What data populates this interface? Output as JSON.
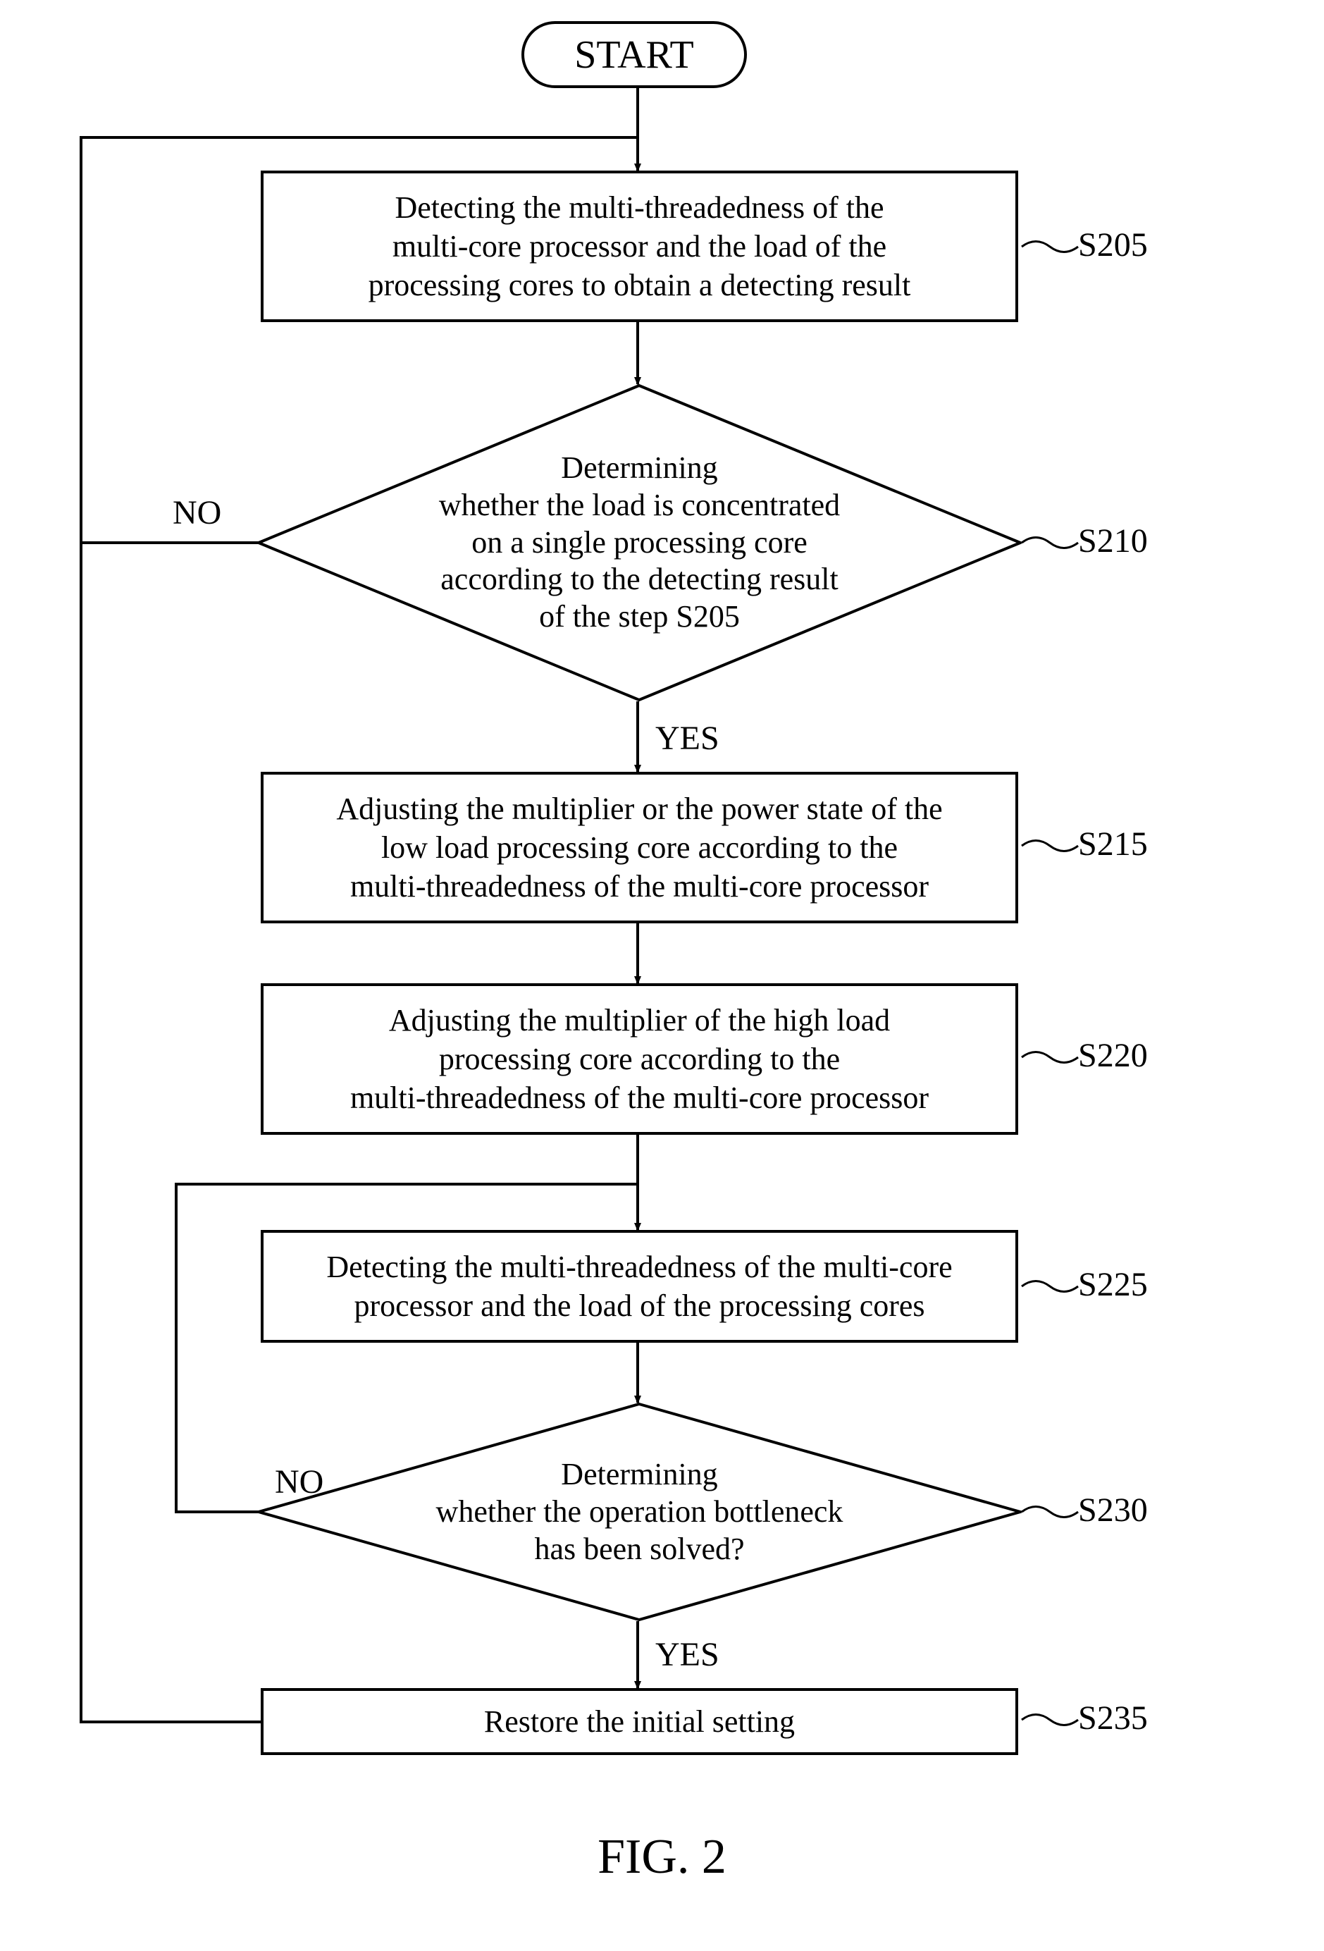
{
  "start": "START",
  "s205": {
    "text": "Detecting the multi-threadedness of the\nmulti-core processor and the load of the\nprocessing cores to obtain a detecting result",
    "id": "S205"
  },
  "s210": {
    "text": "Determining\nwhether the load is concentrated\non a single processing core\naccording to the detecting result\nof the step S205",
    "id": "S210"
  },
  "s215": {
    "text": "Adjusting the multiplier or the power state of the\nlow load processing core according to the\nmulti-threadedness of the multi-core processor",
    "id": "S215"
  },
  "s220": {
    "text": "Adjusting the multiplier of the high load\nprocessing core according to the\nmulti-threadedness of the multi-core processor",
    "id": "S220"
  },
  "s225": {
    "text": "Detecting the multi-threadedness of the multi-core\nprocessor and the load of the processing cores",
    "id": "S225"
  },
  "s230": {
    "text": "Determining\nwhether the operation bottleneck\nhas been solved?",
    "id": "S230"
  },
  "s235": {
    "text": "Restore the initial setting",
    "id": "S235"
  },
  "no": "NO",
  "yes": "YES",
  "fig": "FIG. 2"
}
